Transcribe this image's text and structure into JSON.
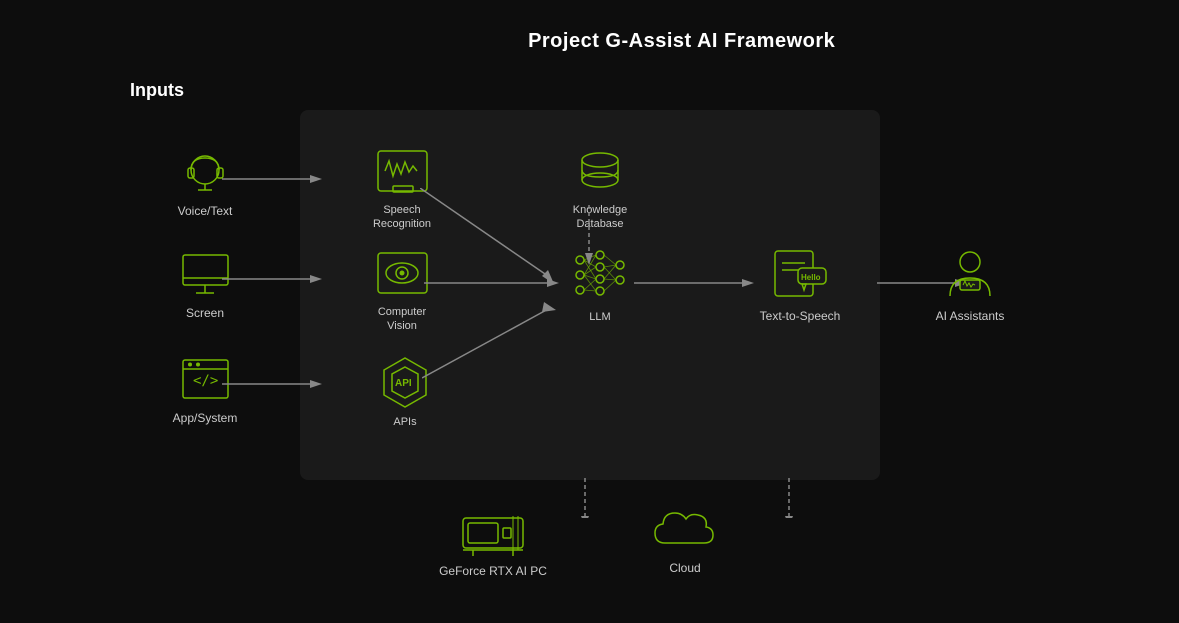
{
  "title": "Project G-Assist AI Framework",
  "inputs_label": "Inputs",
  "inputs": [
    {
      "id": "voice-text",
      "label": "Voice/Text",
      "icon": "headset"
    },
    {
      "id": "screen",
      "label": "Screen",
      "icon": "monitor"
    },
    {
      "id": "app-system",
      "label": "App/System",
      "icon": "code"
    }
  ],
  "framework_items": [
    {
      "id": "speech-recognition",
      "label": "Speech\nRecognition",
      "icon": "waveform"
    },
    {
      "id": "computer-vision",
      "label": "Computer\nVision",
      "icon": "eye"
    },
    {
      "id": "apis",
      "label": "APIs",
      "icon": "api"
    },
    {
      "id": "knowledge-database",
      "label": "Knowledge\nDatabase",
      "icon": "database"
    },
    {
      "id": "llm",
      "label": "LLM",
      "icon": "network"
    }
  ],
  "output_items": [
    {
      "id": "text-to-speech",
      "label": "Text-to-Speech",
      "icon": "tts"
    },
    {
      "id": "ai-assistants",
      "label": "AI Assistants",
      "icon": "ai-person"
    }
  ],
  "bottom_items": [
    {
      "id": "geforce-rtx",
      "label": "GeForce RTX AI PC",
      "icon": "gpu"
    },
    {
      "id": "cloud",
      "label": "Cloud",
      "icon": "cloud"
    }
  ],
  "accent_color": "#76b900",
  "bg_dark": "#1a1a1a"
}
